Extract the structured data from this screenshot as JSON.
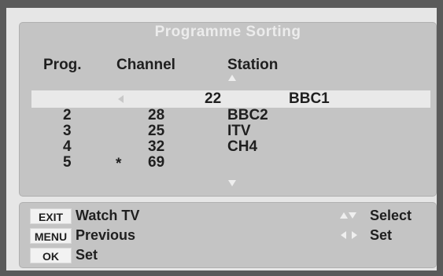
{
  "menu": {
    "title": "Programme Sorting",
    "headers": {
      "prog": "Prog.",
      "channel": "Channel",
      "station": "Station"
    },
    "selected": {
      "channel": "22",
      "station": "BBC1"
    },
    "rows": [
      {
        "prog": "2",
        "mark": "",
        "channel": "28",
        "station": "BBC2"
      },
      {
        "prog": "3",
        "mark": "",
        "channel": "25",
        "station": "ITV"
      },
      {
        "prog": "4",
        "mark": "",
        "channel": "32",
        "station": "CH4"
      },
      {
        "prog": "5",
        "mark": "*",
        "channel": "69",
        "station": ""
      }
    ]
  },
  "help": {
    "exit_key": "EXIT",
    "exit_label": "Watch TV",
    "menu_key": "MENU",
    "menu_label": "Previous",
    "ok_key": "OK",
    "ok_label": "Set",
    "updown_label": "Select",
    "leftright_label": "Set"
  },
  "icons": [
    "arrow-up-icon",
    "arrow-down-icon",
    "arrow-left-icon",
    "arrow-right-icon"
  ],
  "colors": {
    "background": "#c4c4c4",
    "highlight": "#e9e9e9",
    "title": "#ececec",
    "text": "#1f1f1f"
  }
}
